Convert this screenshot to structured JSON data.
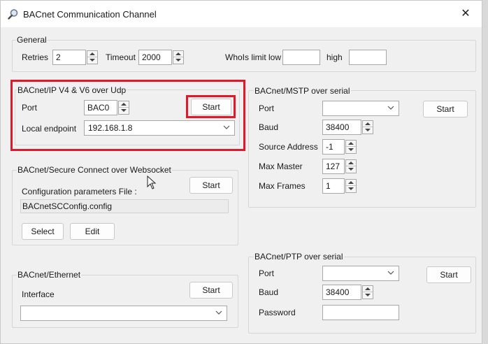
{
  "window": {
    "title": "BACnet Communication Channel",
    "close_glyph": "✕"
  },
  "general": {
    "title": "General",
    "retries_label": "Retries",
    "retries_value": "2",
    "timeout_label": "Timeout",
    "timeout_value": "2000",
    "whois_low_label": "WhoIs limit low",
    "whois_low_value": "",
    "whois_high_label": "high",
    "whois_high_value": ""
  },
  "ip": {
    "title": "BACnet/IP V4 & V6 over Udp",
    "port_label": "Port",
    "port_value": "BAC0",
    "start_label": "Start",
    "endpoint_label": "Local endpoint",
    "endpoint_value": "192.168.1.8"
  },
  "sc": {
    "title": "BACnet/Secure Connect over Websocket",
    "start_label": "Start",
    "config_label": "Configuration parameters File :",
    "config_value": "BACnetSCConfig.config",
    "select_label": "Select",
    "edit_label": "Edit"
  },
  "ethernet": {
    "title": "BACnet/Ethernet",
    "interface_label": "Interface",
    "interface_value": "",
    "start_label": "Start"
  },
  "mstp": {
    "title": "BACnet/MSTP over serial",
    "port_label": "Port",
    "port_value": "",
    "start_label": "Start",
    "baud_label": "Baud",
    "baud_value": "38400",
    "source_label": "Source Address",
    "source_value": "-1",
    "master_label": "Max Master",
    "master_value": "127",
    "frames_label": "Max Frames",
    "frames_value": "1"
  },
  "ptp": {
    "title": "BACnet/PTP over serial",
    "port_label": "Port",
    "port_value": "",
    "start_label": "Start",
    "baud_label": "Baud",
    "baud_value": "38400",
    "password_label": "Password",
    "password_value": ""
  },
  "colors": {
    "highlight": "#e0192a",
    "background": "#f0f0f0"
  },
  "icons": {
    "title": "magnifier-icon",
    "close": "close-icon",
    "dropdown": "chevron-down-icon",
    "spinner": "spinner-arrows-icon",
    "cursor": "mouse-pointer-icon"
  }
}
